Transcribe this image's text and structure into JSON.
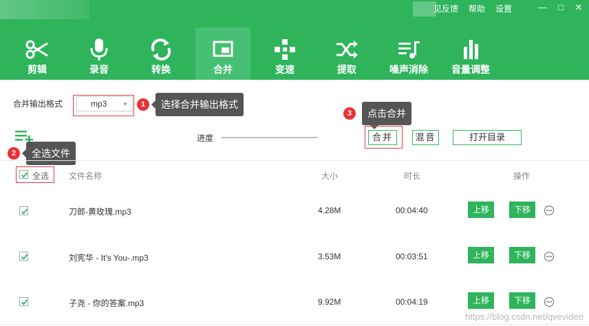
{
  "header": {
    "top_links": [
      "见反馈",
      "帮助",
      "设置"
    ],
    "window_controls": {
      "minimize": "—",
      "maximize": "□",
      "close": "✕"
    },
    "tabs": [
      {
        "label": "剪辑",
        "icon": "scissors-icon"
      },
      {
        "label": "录音",
        "icon": "microphone-icon"
      },
      {
        "label": "转换",
        "icon": "convert-icon"
      },
      {
        "label": "合并",
        "icon": "merge-icon",
        "active": true
      },
      {
        "label": "变速",
        "icon": "speed-icon"
      },
      {
        "label": "提取",
        "icon": "extract-icon"
      },
      {
        "label": "噪声消除",
        "icon": "noise-removal-icon"
      },
      {
        "label": "音量调整",
        "icon": "volume-bars-icon"
      }
    ],
    "bg_color": "#2fb45c",
    "active_tab_color": "#45c073"
  },
  "format": {
    "label": "合并输出格式",
    "selected": "mp3"
  },
  "annotations": [
    {
      "num": "1",
      "text": "选择合并输出格式"
    },
    {
      "num": "2",
      "text": "全选文件"
    },
    {
      "num": "3",
      "text": "点击合并"
    }
  ],
  "toolbar": {
    "progress_label": "进度",
    "merge_button": "合并",
    "mix_button": "混音",
    "open_dir_button": "打开目录"
  },
  "table": {
    "select_all_label": "全选",
    "columns": {
      "name": "文件名称",
      "size": "大小",
      "duration": "时长",
      "actions": "操作"
    },
    "move_up_label": "上移",
    "move_down_label": "下移",
    "rows": [
      {
        "name": "刀郎-黄玫瑰.mp3",
        "size": "4.28M",
        "duration": "00:04:40",
        "checked": true
      },
      {
        "name": "刘宪华 - It's You-.mp3",
        "size": "3.53M",
        "duration": "00:03:51",
        "checked": true
      },
      {
        "name": "子尧 - 你的答案.mp3",
        "size": "9.92M",
        "duration": "00:04:19",
        "checked": true
      }
    ]
  },
  "watermark": "https://blog.csdn.net/qvevideo"
}
